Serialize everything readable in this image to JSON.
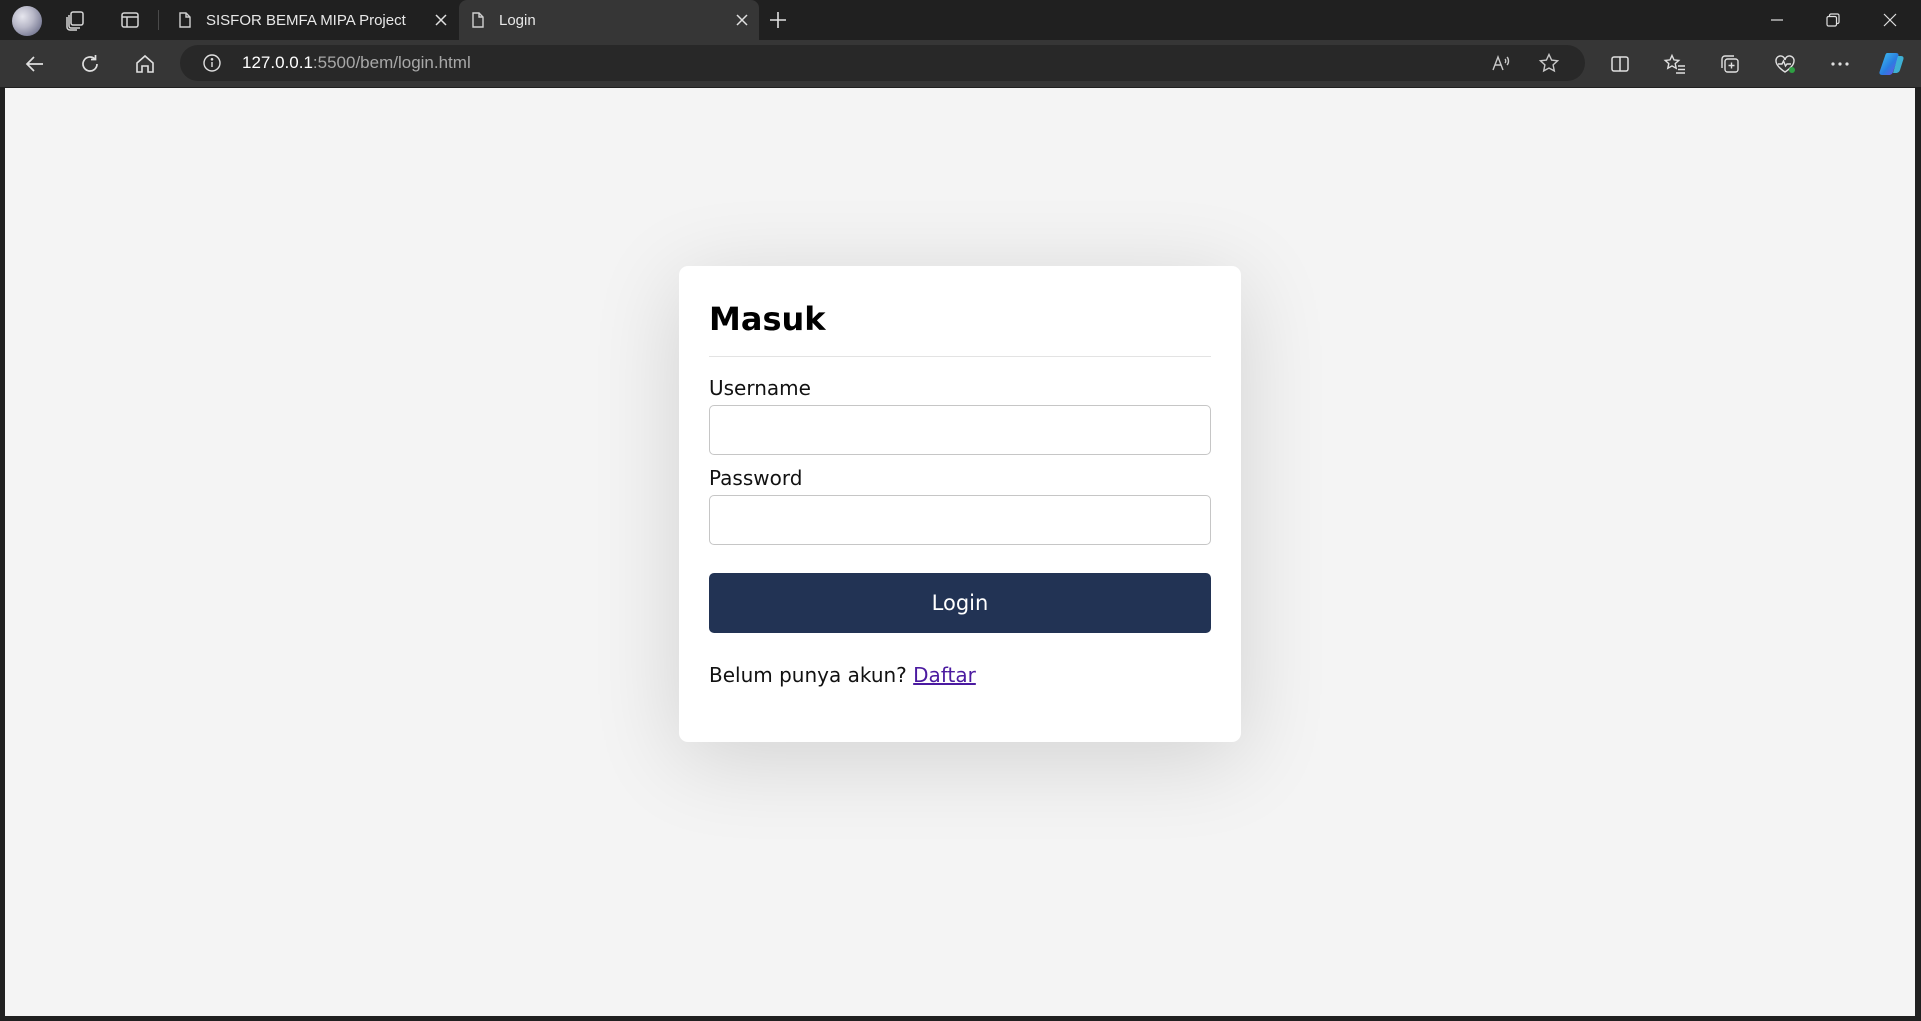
{
  "browser": {
    "tabs": [
      {
        "title": "SISFOR BEMFA MIPA Project",
        "active": false
      },
      {
        "title": "Login",
        "active": true
      }
    ],
    "url": {
      "host": "127.0.0.1",
      "rest": ":5500/bem/login.html"
    },
    "icons": {
      "profile": "profile-avatar-icon",
      "workspaces": "workspaces-icon",
      "tab_actions": "tab-actions-icon",
      "new_tab": "plus-icon",
      "back": "back-arrow-icon",
      "refresh": "refresh-icon",
      "home": "home-icon",
      "site_info": "info-icon",
      "read_aloud": "read-aloud-icon",
      "favorite": "star-icon",
      "split_screen": "split-screen-icon",
      "favorites": "favorites-list-icon",
      "collections": "collections-icon",
      "browser_essentials": "heartbeat-icon",
      "more": "more-dots-icon",
      "copilot": "copilot-icon"
    }
  },
  "login_form": {
    "title": "Masuk",
    "username_label": "Username",
    "username_value": "",
    "password_label": "Password",
    "password_value": "",
    "submit_label": "Login",
    "signup_prompt": "Belum punya akun?",
    "signup_link": "Daftar"
  },
  "colors": {
    "page_background": "#f4f4f4",
    "card_background": "#ffffff",
    "button_background": "#223354",
    "link_color": "#4b1aa0",
    "chrome_dark": "#202020",
    "chrome_bar": "#363636"
  }
}
